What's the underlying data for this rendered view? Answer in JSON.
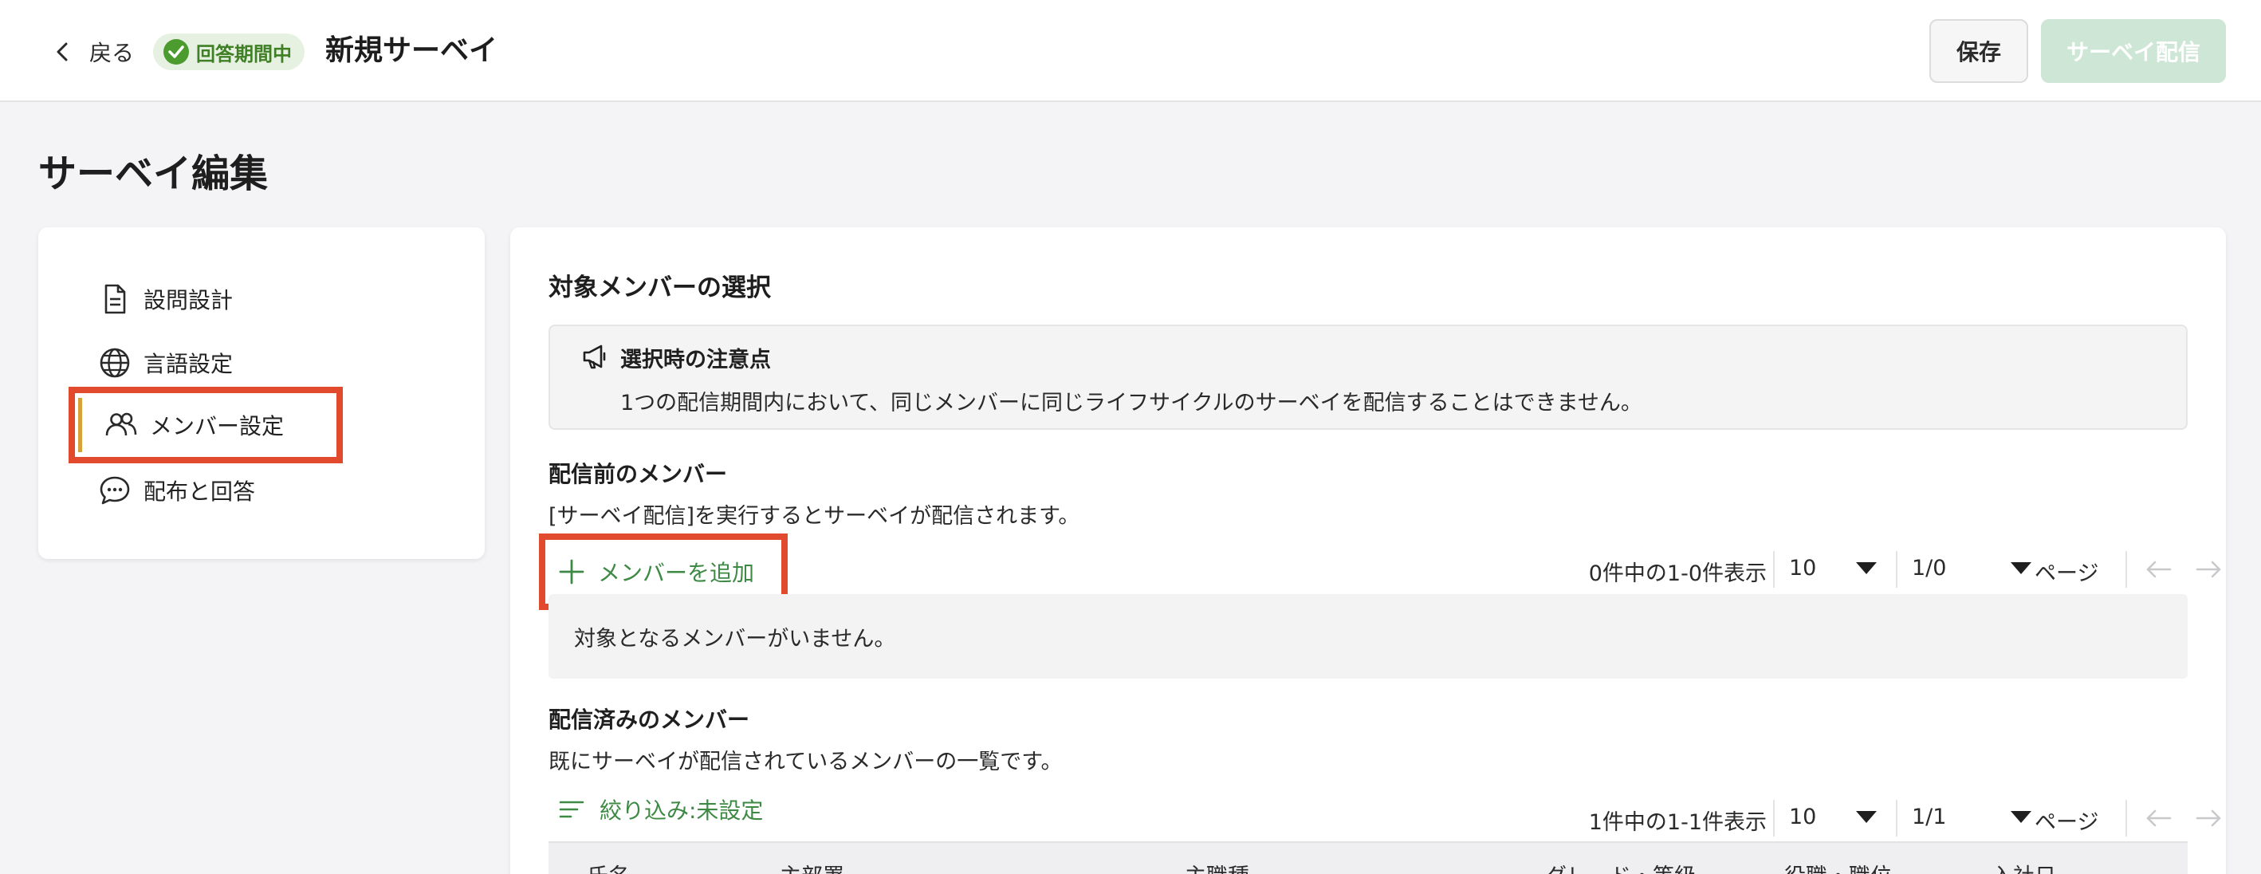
{
  "header": {
    "back_label": "戻る",
    "status_badge": "回答期間中",
    "title": "新規サーベイ",
    "save_label": "保存",
    "send_label": "サーベイ配信"
  },
  "page_heading": "サーベイ編集",
  "sidebar": {
    "items": [
      {
        "label": "設問設計",
        "icon": "document-icon"
      },
      {
        "label": "言語設定",
        "icon": "globe-icon"
      },
      {
        "label": "メンバー設定",
        "icon": "users-icon",
        "active": true
      },
      {
        "label": "配布と回答",
        "icon": "chat-bubble-icon"
      }
    ]
  },
  "main": {
    "section_title": "対象メンバーの選択",
    "notice": {
      "heading": "選択時の注意点",
      "body": "1つの配信期間内において、同じメンバーに同じライフサイクルのサーベイを配信することはできません。"
    },
    "pre_delivery": {
      "heading": "配信前のメンバー",
      "description": "[サーベイ配信]を実行するとサーベイが配信されます。",
      "add_label": "メンバーを追加",
      "pager": {
        "count_text": "0件中の1-0件表示",
        "per_page": "10",
        "page_value": "1/0",
        "page_label": "ページ"
      },
      "empty_text": "対象となるメンバーがいません。"
    },
    "delivered": {
      "heading": "配信済みのメンバー",
      "description": "既にサーベイが配信されているメンバーの一覧です。",
      "filter_label": "絞り込み:未設定",
      "pager": {
        "count_text": "1件中の1-1件表示",
        "per_page": "10",
        "page_value": "1/1",
        "page_label": "ページ"
      },
      "columns": [
        "氏名",
        "主部署",
        "主職種",
        "グレード・等級",
        "役職・職位",
        "入社日"
      ]
    }
  },
  "colors": {
    "accent_green": "#3e8a45",
    "badge_bg": "#e6f1e1",
    "highlight_red": "#e24a2e",
    "send_button_disabled": "#cde6d6"
  }
}
